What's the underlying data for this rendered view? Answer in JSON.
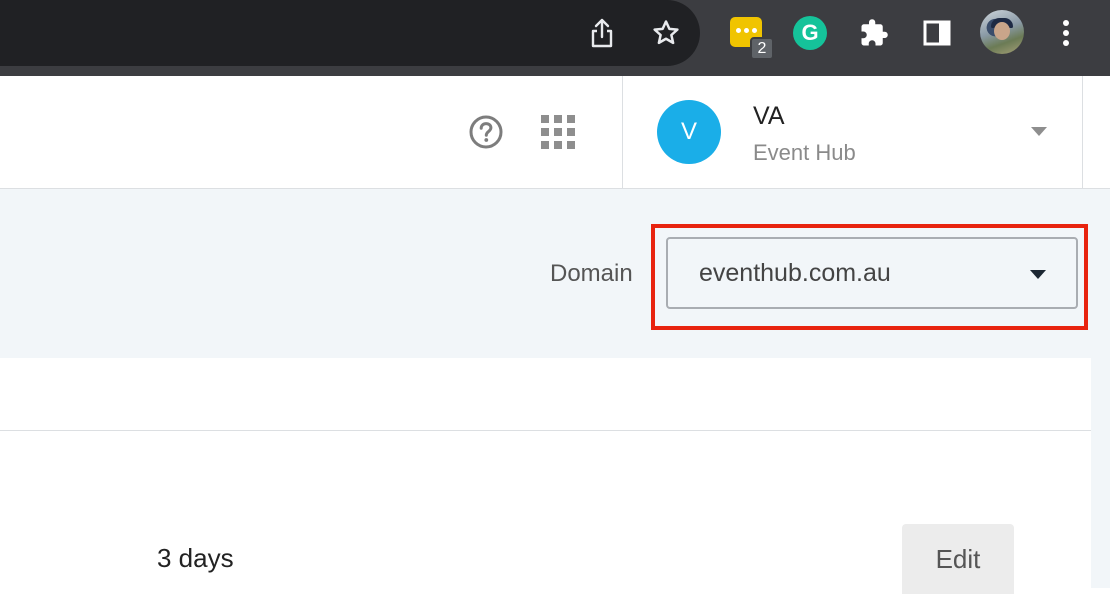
{
  "browser": {
    "extension_badge_count": "2",
    "grammarly_letter": "G",
    "icons": [
      "share-icon",
      "bookmark-star-icon",
      "extension-icon",
      "grammarly-icon",
      "extensions-puzzle-icon",
      "side-panel-icon",
      "profile-avatar",
      "more-menu-icon"
    ]
  },
  "header": {
    "account": {
      "avatar_letter": "V",
      "name": "VA",
      "organization": "Event Hub"
    },
    "icons": [
      "help-icon",
      "apps-grid-icon",
      "account-caret-icon"
    ]
  },
  "domain_filter": {
    "label": "Domain",
    "selected": "eventhub.com.au"
  },
  "content": {
    "period_value": "3 days",
    "edit_label": "Edit"
  },
  "colors": {
    "avatar": "#1aaee8",
    "highlight": "#e8230f",
    "band_background": "#f2f6f9",
    "grammarly": "#15c39a",
    "extension_yellow": "#f0c400"
  }
}
